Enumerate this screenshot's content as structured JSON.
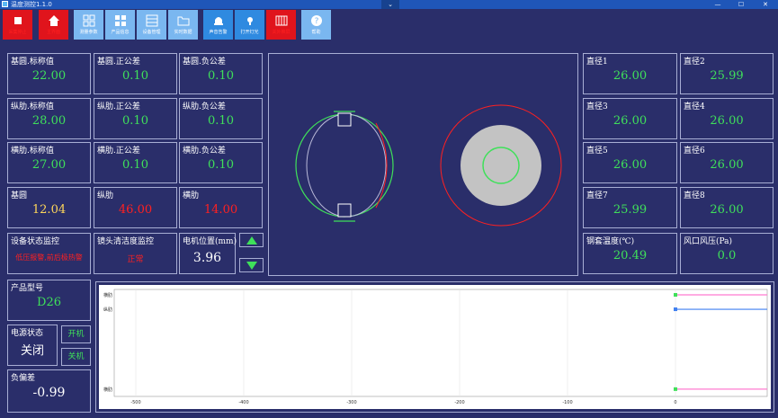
{
  "window": {
    "title": "温度测控1.1.0",
    "collapse_glyph": "⌄",
    "min_glyph": "—",
    "max_glyph": "☐",
    "close_glyph": "✕"
  },
  "toolbar": {
    "stop": "采集停止",
    "home": "主界面",
    "params": "测量参数",
    "products": "产品信息",
    "devices": "设备管理",
    "data": "实时数据",
    "sound": "声音告警",
    "light": "打开灯光",
    "shutdown": "关外推屏",
    "help": "帮助"
  },
  "left": {
    "base_nominal": {
      "label": "基圆.标称值",
      "value": "22.00"
    },
    "base_plus": {
      "label": "基圆.正公差",
      "value": "0.10"
    },
    "base_minus": {
      "label": "基圆.负公差",
      "value": "0.10"
    },
    "long_nominal": {
      "label": "纵肋.标称值",
      "value": "28.00"
    },
    "long_plus": {
      "label": "纵肋.正公差",
      "value": "0.10"
    },
    "long_minus": {
      "label": "纵肋.负公差",
      "value": "0.10"
    },
    "trans_nominal": {
      "label": "横肋.标称值",
      "value": "27.00"
    },
    "trans_plus": {
      "label": "横肋.正公差",
      "value": "0.10"
    },
    "trans_minus": {
      "label": "横肋.负公差",
      "value": "0.10"
    },
    "base_measured": {
      "label": "基圆",
      "value": "12.04"
    },
    "long_measured": {
      "label": "纵肋",
      "value": "46.00"
    },
    "trans_measured": {
      "label": "横肋",
      "value": "14.00"
    },
    "device_status": {
      "label": "设备状态监控",
      "value": "低压报警,前后极热警"
    },
    "lens_status": {
      "label": "镜头清洁度监控",
      "value": "正常"
    },
    "motor": {
      "label": "电机位置(mm)",
      "value": "3.96"
    },
    "product_model": {
      "label": "产品型号",
      "value": "D26"
    },
    "power": {
      "label": "电源状态",
      "value": "关闭"
    },
    "power_on": "开机",
    "power_off": "关机",
    "neg_dev": {
      "label": "负偏差",
      "value": "-0.99"
    }
  },
  "right": {
    "d1": {
      "label": "直径1",
      "value": "26.00"
    },
    "d2": {
      "label": "直径2",
      "value": "25.99"
    },
    "d3": {
      "label": "直径3",
      "value": "26.00"
    },
    "d4": {
      "label": "直径4",
      "value": "26.00"
    },
    "d5": {
      "label": "直径5",
      "value": "26.00"
    },
    "d6": {
      "label": "直径6",
      "value": "26.00"
    },
    "d7": {
      "label": "直径7",
      "value": "25.99"
    },
    "d8": {
      "label": "直径8",
      "value": "26.00"
    },
    "temp": {
      "label": "钢套温度(℃)",
      "value": "20.49"
    },
    "wind": {
      "label": "风口风压(Pa)",
      "value": "0.0"
    }
  },
  "colors": {
    "background": "#2a2e6a",
    "border": "#a8aed4",
    "value_green": "#3fe05a",
    "value_yellow": "#ffd75a",
    "value_red": "#ff2020",
    "toolbar_red": "#e0141c",
    "toolbar_blue": "#2f8ae0"
  },
  "chart_data": {
    "type": "line",
    "xlabel": "",
    "ylabel": "",
    "xlim": [
      -520,
      85
    ],
    "x_ticks": [
      "-500",
      "-400",
      "-300",
      "-200",
      "-100",
      "0"
    ],
    "y_tick_labels": [
      "横肋",
      "纵肋",
      "横肋"
    ],
    "grid": true,
    "series": [
      {
        "color": "#ff7bd0",
        "x": [
          0,
          85
        ],
        "y": [
          1,
          1
        ]
      },
      {
        "color": "#3f7ff0",
        "x": [
          0,
          85
        ],
        "y": [
          0.85,
          0.85
        ]
      },
      {
        "color": "#ff7bd0",
        "x": [
          0,
          85
        ],
        "y": [
          0.02,
          0.02
        ]
      }
    ]
  }
}
